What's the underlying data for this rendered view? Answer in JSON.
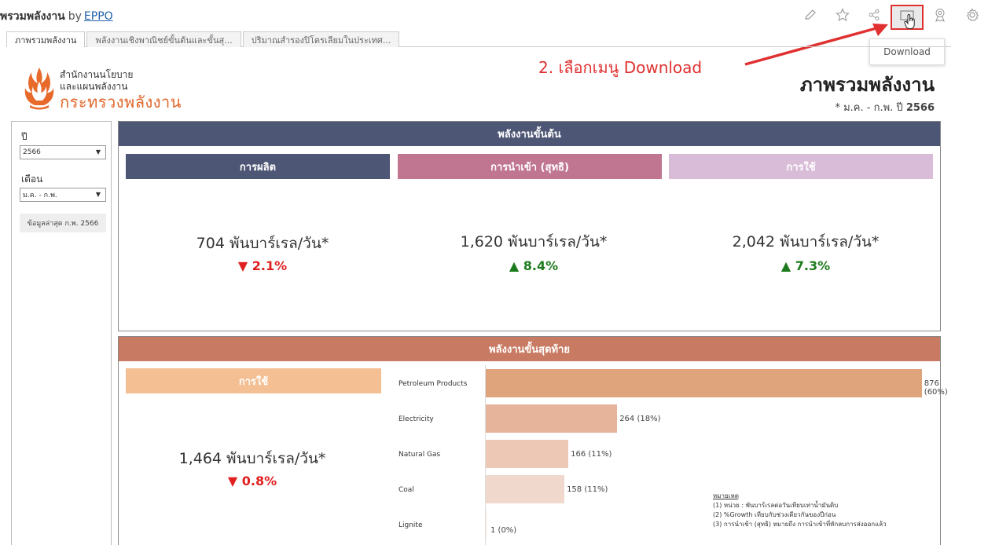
{
  "app": {
    "title": "พรวมพลังงาน",
    "by": "by",
    "author_link": "EPPO",
    "download_tooltip": "Download"
  },
  "tabs": [
    {
      "label": "ภาพรวมพลังงาน"
    },
    {
      "label": "พลังงานเชิงพาณิชย์ขั้นต้นและขั้นสุ..."
    },
    {
      "label": "ปริมาณสำรองปิโตรเลียมในประเทศ..."
    }
  ],
  "logo": {
    "line1": "สำนักงานนโยบาย",
    "line2": "และแผนพลังงาน",
    "line3": "กระทรวงพลังงาน"
  },
  "annotation": "2. เลือกเมนู Download",
  "page": {
    "heading": "ภาพรวมพลังงาน",
    "subtitle_prefix": "* ม.ค. - ก.พ. ปี",
    "subtitle_year": "2566"
  },
  "filter": {
    "year_label": "ปี",
    "year_value": "2566",
    "month_label": "เดือน",
    "month_value": "ม.ค. - ก.พ.",
    "latest_button": "ข้อมูลล่าสุด ก.พ. 2566"
  },
  "primary": {
    "header": "พลังงานขั้นต้น",
    "cards": [
      {
        "title": "การผลิต",
        "value": "704 พันบาร์เรล/วัน*",
        "change": "▼ 2.1%",
        "direction": "down",
        "color": "#4e5675"
      },
      {
        "title": "การนำเข้า (สุทธิ)",
        "value": "1,620 พันบาร์เรล/วัน*",
        "change": "▲ 8.4%",
        "direction": "up",
        "color": "#c07590"
      },
      {
        "title": "การใช้",
        "value": "2,042 พันบาร์เรล/วัน*",
        "change": "▲ 7.3%",
        "direction": "up",
        "color": "#d9bcd7"
      }
    ]
  },
  "final": {
    "header": "พลังงานขั้นสุดท้าย",
    "card": {
      "title": "การใช้",
      "value": "1,464 พันบาร์เรล/วัน*",
      "change": "▼ 0.8%",
      "direction": "down",
      "color": "#f4bf92"
    }
  },
  "chart_data": {
    "type": "bar",
    "orientation": "horizontal",
    "categories": [
      "Petroleum Products",
      "Electricity",
      "Natural Gas",
      "Coal",
      "Lignite"
    ],
    "values": [
      876,
      264,
      166,
      158,
      1
    ],
    "value_labels": [
      "876 (60%)",
      "264 (18%)",
      "166 (11%)",
      "158 (11%)",
      "1 (0%)"
    ],
    "colors": [
      "#e0a47d",
      "#e6b49a",
      "#edc8b4",
      "#f1d8cc",
      "#f6e8e0"
    ],
    "max": 900
  },
  "notes": {
    "heading": "หมายเหตุ",
    "lines": [
      "(1) หน่วย : พันบาร์เรลต่อวันเทียบเท่าน้ำมันดิบ",
      "(2) %Growth เทียบกับช่วงเดียวกันของปีก่อน",
      "(3) การนำเข้า (สุทธิ) หมายถึง การนำเข้าที่หักลบการส่งออกแล้ว"
    ]
  },
  "colors": {
    "primary_header": "#4e5675",
    "final_header": "#c87b62",
    "annotation": "#e03030"
  },
  "icons": [
    "edit-icon",
    "star-icon",
    "share-icon",
    "download-icon",
    "badge-icon",
    "settings-icon"
  ]
}
